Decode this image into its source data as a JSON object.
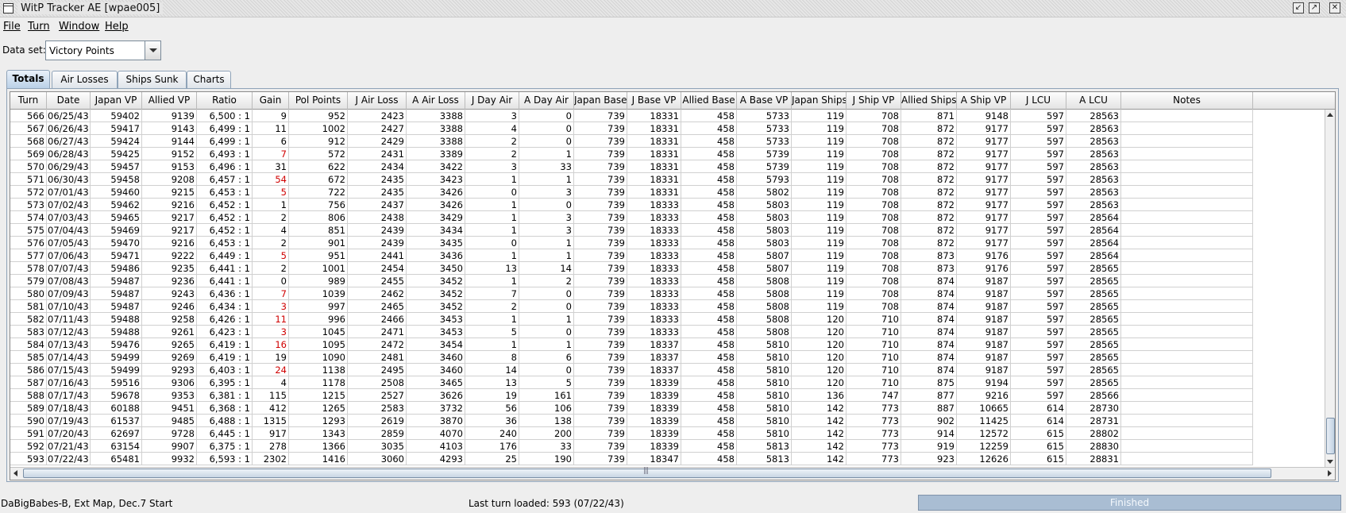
{
  "window": {
    "title": "WitP Tracker AE [wpae005]",
    "buttons": [
      "minimize",
      "maximize",
      "close"
    ]
  },
  "menu": [
    "File",
    "Turn",
    "Window",
    "Help"
  ],
  "dataset": {
    "label": "Data set:",
    "value": "Victory Points"
  },
  "tabs": [
    {
      "label": "Totals",
      "active": true
    },
    {
      "label": "Air Losses",
      "active": false
    },
    {
      "label": "Ships Sunk",
      "active": false
    },
    {
      "label": "Charts",
      "active": false
    }
  ],
  "table": {
    "columns": [
      "Turn",
      "Date",
      "Japan VP",
      "Allied VP",
      "Ratio",
      "Gain",
      "Pol Points",
      "J Air Loss",
      "A Air Loss",
      "J Day Air",
      "A Day Air",
      "Japan Base",
      "J Base VP",
      "Allied Base",
      "A Base VP",
      "Japan Ships",
      "J Ship VP",
      "Allied Ships",
      "A Ship VP",
      "J LCU",
      "A LCU",
      "Notes"
    ],
    "rows": [
      [
        "566",
        "06/25/43",
        "59402",
        "9139",
        "6,500 : 1",
        "9",
        "952",
        "2423",
        "3388",
        "3",
        "0",
        "739",
        "18331",
        "458",
        "5733",
        "119",
        "708",
        "871",
        "9148",
        "597",
        "28563",
        ""
      ],
      [
        "567",
        "06/26/43",
        "59417",
        "9143",
        "6,499 : 1",
        "11",
        "1002",
        "2427",
        "3388",
        "4",
        "0",
        "739",
        "18331",
        "458",
        "5733",
        "119",
        "708",
        "872",
        "9177",
        "597",
        "28563",
        ""
      ],
      [
        "568",
        "06/27/43",
        "59424",
        "9144",
        "6,499 : 1",
        "6",
        "912",
        "2429",
        "3388",
        "2",
        "0",
        "739",
        "18331",
        "458",
        "5733",
        "119",
        "708",
        "872",
        "9177",
        "597",
        "28563",
        ""
      ],
      [
        "569",
        "06/28/43",
        "59425",
        "9152",
        "6,493 : 1",
        "7",
        "572",
        "2431",
        "3389",
        "2",
        "1",
        "739",
        "18331",
        "458",
        "5739",
        "119",
        "708",
        "872",
        "9177",
        "597",
        "28563",
        ""
      ],
      [
        "570",
        "06/29/43",
        "59457",
        "9153",
        "6,496 : 1",
        "31",
        "622",
        "2434",
        "3422",
        "3",
        "33",
        "739",
        "18331",
        "458",
        "5739",
        "119",
        "708",
        "872",
        "9177",
        "597",
        "28563",
        ""
      ],
      [
        "571",
        "06/30/43",
        "59458",
        "9208",
        "6,457 : 1",
        "54",
        "672",
        "2435",
        "3423",
        "1",
        "1",
        "739",
        "18331",
        "458",
        "5793",
        "119",
        "708",
        "872",
        "9177",
        "597",
        "28563",
        ""
      ],
      [
        "572",
        "07/01/43",
        "59460",
        "9215",
        "6,453 : 1",
        "5",
        "722",
        "2435",
        "3426",
        "0",
        "3",
        "739",
        "18331",
        "458",
        "5802",
        "119",
        "708",
        "872",
        "9177",
        "597",
        "28563",
        ""
      ],
      [
        "573",
        "07/02/43",
        "59462",
        "9216",
        "6,452 : 1",
        "1",
        "756",
        "2437",
        "3426",
        "1",
        "0",
        "739",
        "18333",
        "458",
        "5803",
        "119",
        "708",
        "872",
        "9177",
        "597",
        "28563",
        ""
      ],
      [
        "574",
        "07/03/43",
        "59465",
        "9217",
        "6,452 : 1",
        "2",
        "806",
        "2438",
        "3429",
        "1",
        "3",
        "739",
        "18333",
        "458",
        "5803",
        "119",
        "708",
        "872",
        "9177",
        "597",
        "28564",
        ""
      ],
      [
        "575",
        "07/04/43",
        "59469",
        "9217",
        "6,452 : 1",
        "4",
        "851",
        "2439",
        "3434",
        "1",
        "3",
        "739",
        "18333",
        "458",
        "5803",
        "119",
        "708",
        "872",
        "9177",
        "597",
        "28564",
        ""
      ],
      [
        "576",
        "07/05/43",
        "59470",
        "9216",
        "6,453 : 1",
        "2",
        "901",
        "2439",
        "3435",
        "0",
        "1",
        "739",
        "18333",
        "458",
        "5803",
        "119",
        "708",
        "872",
        "9177",
        "597",
        "28564",
        ""
      ],
      [
        "577",
        "07/06/43",
        "59471",
        "9222",
        "6,449 : 1",
        "5",
        "951",
        "2441",
        "3436",
        "1",
        "1",
        "739",
        "18333",
        "458",
        "5807",
        "119",
        "708",
        "873",
        "9176",
        "597",
        "28564",
        ""
      ],
      [
        "578",
        "07/07/43",
        "59486",
        "9235",
        "6,441 : 1",
        "2",
        "1001",
        "2454",
        "3450",
        "13",
        "14",
        "739",
        "18333",
        "458",
        "5807",
        "119",
        "708",
        "873",
        "9176",
        "597",
        "28565",
        ""
      ],
      [
        "579",
        "07/08/43",
        "59487",
        "9236",
        "6,441 : 1",
        "0",
        "989",
        "2455",
        "3452",
        "1",
        "2",
        "739",
        "18333",
        "458",
        "5808",
        "119",
        "708",
        "874",
        "9187",
        "597",
        "28565",
        ""
      ],
      [
        "580",
        "07/09/43",
        "59487",
        "9243",
        "6,436 : 1",
        "7",
        "1039",
        "2462",
        "3452",
        "7",
        "0",
        "739",
        "18333",
        "458",
        "5808",
        "119",
        "708",
        "874",
        "9187",
        "597",
        "28565",
        ""
      ],
      [
        "581",
        "07/10/43",
        "59487",
        "9246",
        "6,434 : 1",
        "3",
        "997",
        "2465",
        "3452",
        "2",
        "0",
        "739",
        "18333",
        "458",
        "5808",
        "119",
        "708",
        "874",
        "9187",
        "597",
        "28565",
        ""
      ],
      [
        "582",
        "07/11/43",
        "59488",
        "9258",
        "6,426 : 1",
        "11",
        "996",
        "2466",
        "3453",
        "1",
        "1",
        "739",
        "18333",
        "458",
        "5808",
        "120",
        "710",
        "874",
        "9187",
        "597",
        "28565",
        ""
      ],
      [
        "583",
        "07/12/43",
        "59488",
        "9261",
        "6,423 : 1",
        "3",
        "1045",
        "2471",
        "3453",
        "5",
        "0",
        "739",
        "18333",
        "458",
        "5808",
        "120",
        "710",
        "874",
        "9187",
        "597",
        "28565",
        ""
      ],
      [
        "584",
        "07/13/43",
        "59476",
        "9265",
        "6,419 : 1",
        "16",
        "1095",
        "2472",
        "3454",
        "1",
        "1",
        "739",
        "18337",
        "458",
        "5810",
        "120",
        "710",
        "874",
        "9187",
        "597",
        "28565",
        ""
      ],
      [
        "585",
        "07/14/43",
        "59499",
        "9269",
        "6,419 : 1",
        "19",
        "1090",
        "2481",
        "3460",
        "8",
        "6",
        "739",
        "18337",
        "458",
        "5810",
        "120",
        "710",
        "874",
        "9187",
        "597",
        "28565",
        ""
      ],
      [
        "586",
        "07/15/43",
        "59499",
        "9293",
        "6,403 : 1",
        "24",
        "1138",
        "2495",
        "3460",
        "14",
        "0",
        "739",
        "18337",
        "458",
        "5810",
        "120",
        "710",
        "874",
        "9187",
        "597",
        "28565",
        ""
      ],
      [
        "587",
        "07/16/43",
        "59516",
        "9306",
        "6,395 : 1",
        "4",
        "1178",
        "2508",
        "3465",
        "13",
        "5",
        "739",
        "18339",
        "458",
        "5810",
        "120",
        "710",
        "875",
        "9194",
        "597",
        "28565",
        ""
      ],
      [
        "588",
        "07/17/43",
        "59678",
        "9353",
        "6,381 : 1",
        "115",
        "1215",
        "2527",
        "3626",
        "19",
        "161",
        "739",
        "18339",
        "458",
        "5810",
        "136",
        "747",
        "877",
        "9216",
        "597",
        "28566",
        ""
      ],
      [
        "589",
        "07/18/43",
        "60188",
        "9451",
        "6,368 : 1",
        "412",
        "1265",
        "2583",
        "3732",
        "56",
        "106",
        "739",
        "18339",
        "458",
        "5810",
        "142",
        "773",
        "887",
        "10665",
        "614",
        "28730",
        ""
      ],
      [
        "590",
        "07/19/43",
        "61537",
        "9485",
        "6,488 : 1",
        "1315",
        "1293",
        "2619",
        "3870",
        "36",
        "138",
        "739",
        "18339",
        "458",
        "5810",
        "142",
        "773",
        "902",
        "11425",
        "614",
        "28731",
        ""
      ],
      [
        "591",
        "07/20/43",
        "62697",
        "9728",
        "6,445 : 1",
        "917",
        "1343",
        "2859",
        "4070",
        "240",
        "200",
        "739",
        "18339",
        "458",
        "5810",
        "142",
        "773",
        "914",
        "12572",
        "615",
        "28802",
        ""
      ],
      [
        "592",
        "07/21/43",
        "63154",
        "9907",
        "6,375 : 1",
        "278",
        "1366",
        "3035",
        "4103",
        "176",
        "33",
        "739",
        "18339",
        "458",
        "5813",
        "142",
        "773",
        "919",
        "12259",
        "615",
        "28830",
        ""
      ],
      [
        "593",
        "07/22/43",
        "65481",
        "9932",
        "6,593 : 1",
        "2302",
        "1416",
        "3060",
        "4293",
        "25",
        "190",
        "739",
        "18347",
        "458",
        "5813",
        "142",
        "773",
        "923",
        "12626",
        "615",
        "28831",
        ""
      ]
    ],
    "red_gain_turns": [
      "569",
      "571",
      "572",
      "577",
      "580",
      "581",
      "582",
      "583",
      "584",
      "586"
    ]
  },
  "status": {
    "left": "DaBigBabes-B, Ext Map, Dec.7 Start",
    "middle": "Last turn loaded: 593 (07/22/43)",
    "progress_label": "Finished",
    "progress_fraction": 1.0
  },
  "colors": {
    "accent": "#a9bdd3",
    "red_text": "#d00000"
  }
}
